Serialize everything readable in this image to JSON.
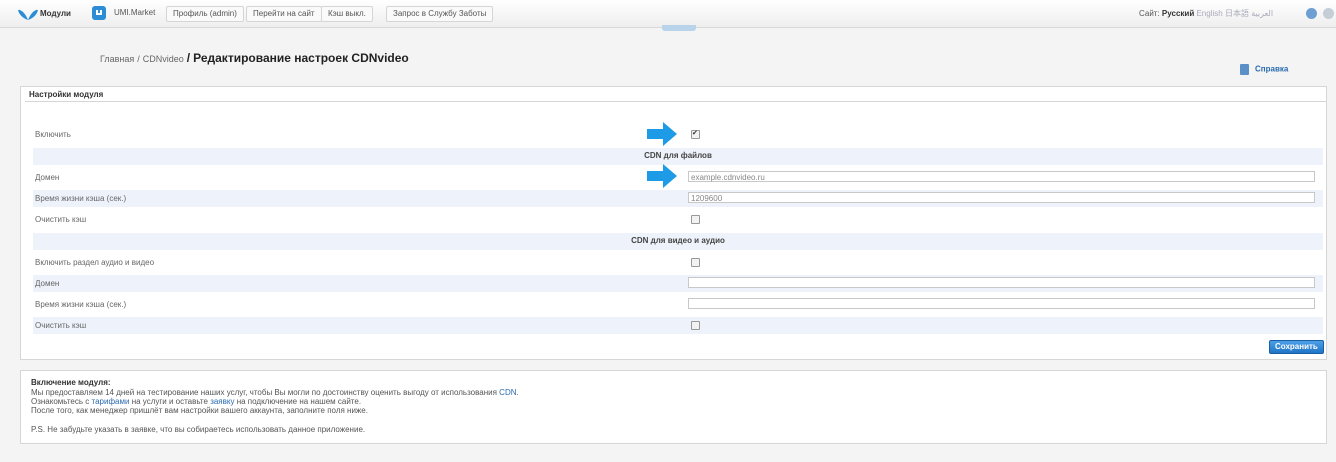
{
  "topbar": {
    "modules_label": "Модули",
    "market_label": "UMI.Market",
    "profile_label": "Профиль (admin)",
    "goto_site_label": "Перейти на сайт",
    "cache_label": "Кэш выкл.",
    "support_label": "Запрос в Службу Заботы",
    "site_label": "Сайт:",
    "lang_current": "Русский",
    "lang_english": "English",
    "lang_cn": "日本語",
    "lang_ar": "العربية"
  },
  "breadcrumb": {
    "home": "Главная",
    "section": "CDNvideo",
    "current": "Редактирование настроек CDNvideo"
  },
  "help_label": "Справка",
  "panel": {
    "title": "Настройки модуля",
    "enable_label": "Включить",
    "enable_checked": true,
    "files_section": "CDN для файлов",
    "files_domain_label": "Домен",
    "files_domain_value": "example.cdnvideo.ru",
    "files_cache_label": "Время жизни кэша (сек.)",
    "files_cache_value": "1209600",
    "files_clear_label": "Очистить кэш",
    "video_section": "CDN для видео и аудио",
    "video_enable_label": "Включить раздел аудио и видео",
    "video_domain_label": "Домен",
    "video_domain_value": "",
    "video_cache_label": "Время жизни кэша (сек.)",
    "video_cache_value": "",
    "video_clear_label": "Очистить кэш",
    "save_label": "Сохранить"
  },
  "info": {
    "title": "Включение модуля:",
    "line1_pre": "Мы предоставляем 14 дней на тестирование наших услуг, чтобы Вы могли по достоинству оценить выгоду от использования",
    "line1_link": "CDN",
    "line2_a": "Ознакомьтесь с",
    "line2_link1": "тарифами",
    "line2_b": "на услуги и оставьте",
    "line2_link2": "заявку",
    "line2_c": "на подключение на нашем сайте.",
    "line3": "После того, как менеджер пришлёт вам настройки вашего аккаунта, заполните поля ниже.",
    "line4": "P.S. Не забудьте указать в заявке, что вы собираетесь использовать данное приложение."
  },
  "colors": {
    "accent": "#2c8dd6",
    "row_alt": "#eef3fb",
    "link": "#2a6bb0"
  }
}
